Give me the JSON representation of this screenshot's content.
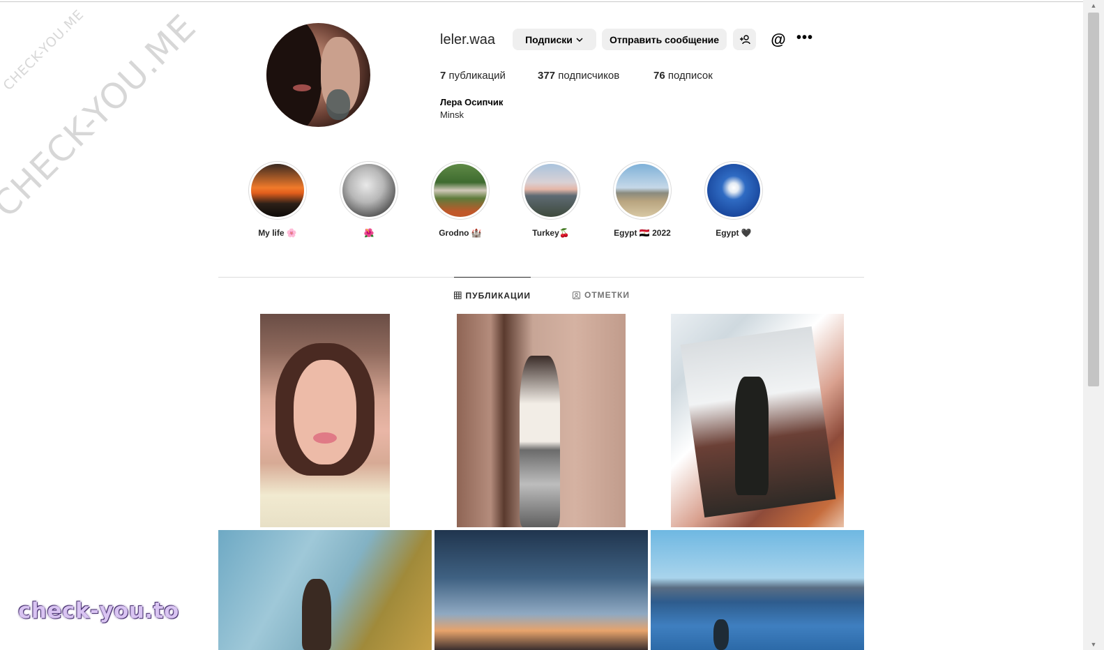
{
  "watermark": {
    "small": "CHECK-YOU.ME",
    "large": "CHECK-YOU.ME",
    "brand": "check-you.to"
  },
  "profile": {
    "username": "leler.waa",
    "follow_button": "Подписки",
    "message_button": "Отправить сообщение",
    "threads_icon": "@",
    "more_icon": "•••",
    "stats": {
      "posts_count": "7",
      "posts_label": "публикаций",
      "followers_count": "377",
      "followers_label": "подписчиков",
      "following_count": "76",
      "following_label": "подписок"
    },
    "full_name": "Лера Осипчик",
    "bio": "Minsk"
  },
  "highlights": [
    {
      "label": "My life 🌸"
    },
    {
      "label": "🌺"
    },
    {
      "label": "Grodno 🏰"
    },
    {
      "label": "Turkey🍒"
    },
    {
      "label": "Egypt 🇪🇬 2022"
    },
    {
      "label": "Egypt 🖤"
    }
  ],
  "tabs": {
    "posts": "ПУБЛИКАЦИИ",
    "tagged": "ОТМЕТКИ"
  },
  "colors": {
    "button_bg": "#efefef",
    "divider": "#dbdbdb",
    "text_primary": "#262626",
    "text_secondary": "#737373"
  }
}
